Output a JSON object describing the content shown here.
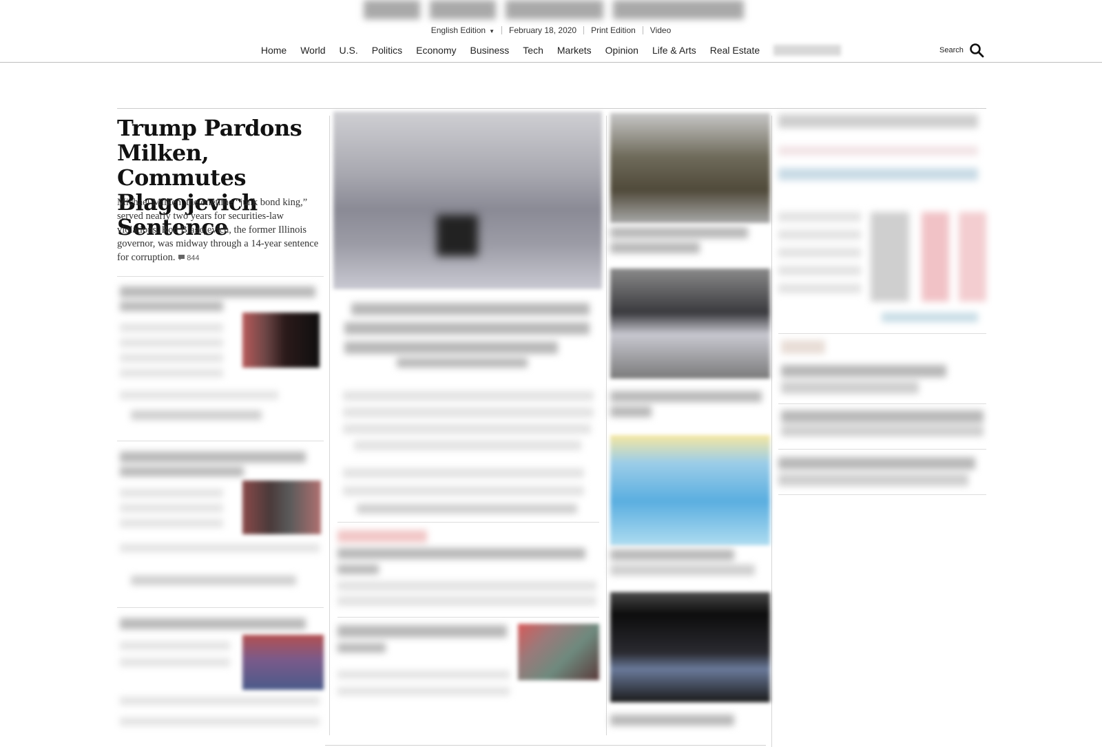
{
  "header": {
    "edition_label": "English Edition",
    "date": "February 18, 2020",
    "print_edition": "Print Edition",
    "video": "Video",
    "search_label": "Search"
  },
  "nav": {
    "items": [
      "Home",
      "World",
      "U.S.",
      "Politics",
      "Economy",
      "Business",
      "Tech",
      "Markets",
      "Opinion",
      "Life & Arts",
      "Real Estate"
    ]
  },
  "lead": {
    "headline": "Trump Pardons Milken, Commutes Blagojevich Sentence",
    "summary": "Michael Milken, the onetime “junk bond king,” served nearly two years for securities-law violations. Rod Blagojevich, the former Illinois governor, was midway through a 14-year sentence for corruption.",
    "comment_count": "844"
  },
  "icons": {
    "search": "search-icon",
    "comment": "comment-icon",
    "caret": "caret-down-icon"
  }
}
